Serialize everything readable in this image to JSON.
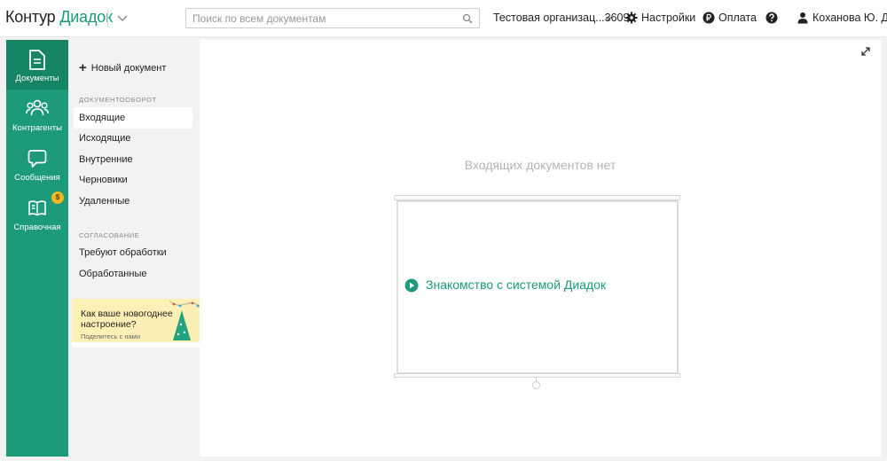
{
  "header": {
    "logo_part1": "Контур",
    "logo_part2": "Диадок",
    "search_placeholder": "Поиск по всем документам",
    "organization": "Тестовая организац...3609",
    "settings_label": "Настройки",
    "payment_label": "Оплата",
    "user_name": "Коханова Ю. Д."
  },
  "leftnav": {
    "items": [
      {
        "label": "Документы",
        "icon": "document-icon",
        "active": true
      },
      {
        "label": "Контрагенты",
        "icon": "people-icon",
        "active": false
      },
      {
        "label": "Сообщения",
        "icon": "message-icon",
        "active": false
      },
      {
        "label": "Справочная",
        "icon": "book-icon",
        "active": false,
        "badge": "$"
      }
    ]
  },
  "sidebar": {
    "new_document": "Новый документ",
    "section1_title": "ДОКУМЕНТООБОРОТ",
    "section1_items": [
      "Входящие",
      "Исходящие",
      "Внутренние",
      "Черновики",
      "Удаленные"
    ],
    "section2_title": "СОГЛАСОВАНИЕ",
    "section2_items": [
      "Требуют обработки",
      "Обработанные"
    ],
    "promo_question": "Как ваше новогоднее настроение?",
    "promo_link": "Поделитесь с нами"
  },
  "main": {
    "empty_message": "Входящих документов нет",
    "intro_link": "Знакомство с системой Диадок"
  },
  "colors": {
    "brand_green": "#1c9a79",
    "active_nav": "#168566",
    "promo_bg": "#fdf0b6",
    "badge": "#f0b624"
  }
}
